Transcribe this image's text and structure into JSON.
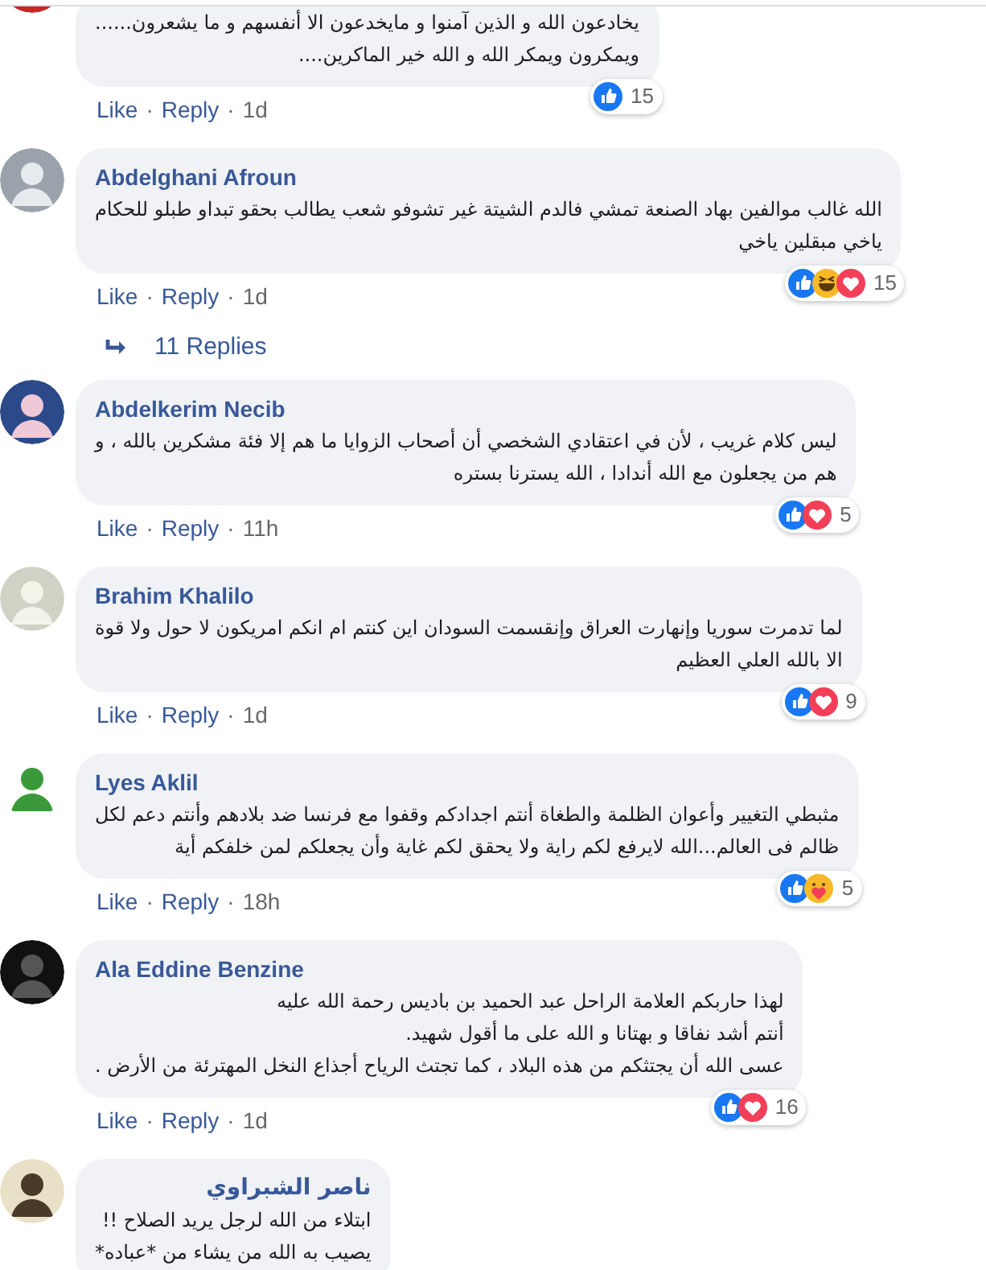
{
  "comments": [
    {
      "lines": [
        "يخادعون الله و الذين آمنوا و مايخدعون الا أنفسهم و ما يشعرون......",
        "ويمكرون ويمكر الله و الله خير الماكرين...."
      ],
      "reactions": {
        "icons": [
          {
            "kind": "like"
          }
        ],
        "count": "15"
      },
      "actions": {
        "like": "Like",
        "separator_1": "·",
        "reply": "Reply",
        "separator_2": "·",
        "time": "1d"
      }
    },
    {
      "name": "Abdelghani Afroun",
      "lines": [
        "الله غالب موالفين بهاد الصنعة تمشي فالدم الشيتة غير تشوفو شعب يطالب بحقو تبداو طبلو للحكام",
        "ياخي مبقلين ياخي"
      ],
      "reactions": {
        "icons": [
          {
            "kind": "like"
          },
          {
            "kind": "haha"
          },
          {
            "kind": "love"
          }
        ],
        "count": "15"
      },
      "actions": {
        "like": "Like",
        "separator_1": "·",
        "reply": "Reply",
        "separator_2": "·",
        "time": "1d"
      },
      "replies": "11 Replies"
    },
    {
      "name": "Abdelkerim Necib",
      "lines": [
        "ليس كلام غريب ، لأن في اعتقادي الشخصي أن أصحاب الزوايا ما هم إلا فئة مشكرين بالله ، و",
        "هم من يجعلون مع الله أندادا ، الله يسترنا بستره"
      ],
      "reactions": {
        "icons": [
          {
            "kind": "like"
          },
          {
            "kind": "love"
          }
        ],
        "count": "5"
      },
      "actions": {
        "like": "Like",
        "separator_1": "·",
        "reply": "Reply",
        "separator_2": "·",
        "time": "11h"
      }
    },
    {
      "name": "Brahim Khalilo",
      "lines": [
        "لما تدمرت سوريا وإنهارت العراق وإنقسمت السودان اين كنتم ام انكم امريكون لا حول ولا قوة",
        "الا بالله العلي العظيم"
      ],
      "reactions": {
        "icons": [
          {
            "kind": "like"
          },
          {
            "kind": "love"
          }
        ],
        "count": "9"
      },
      "actions": {
        "like": "Like",
        "separator_1": "·",
        "reply": "Reply",
        "separator_2": "·",
        "time": "1d"
      }
    },
    {
      "name": "Lyes Aklil",
      "lines": [
        "مثبطي التغيير وأعوان الظلمة والطغاة أنتم اجدادكم وقفوا مع فرنسا ضد بلادهم وأنتم دعم لكل",
        "ظالم فى العالم...الله لايرفع لكم راية ولا يحقق لكم غاية وأن يجعلكم لمن خلفكم أية"
      ],
      "reactions": {
        "icons": [
          {
            "kind": "like"
          },
          {
            "kind": "care"
          }
        ],
        "count": "5"
      },
      "actions": {
        "like": "Like",
        "separator_1": "·",
        "reply": "Reply",
        "separator_2": "·",
        "time": "18h"
      }
    },
    {
      "name": "Ala Eddine Benzine",
      "lines": [
        "لهذا حاربكم العلامة الراحل عبد الحميد بن باديس رحمة الله عليه",
        "أنتم أشد نفاقا و بهتانا و الله على ما أقول شهيد.",
        "عسى الله أن يجتثكم من هذه البلاد ، كما تجتث الرياح أجذاع النخل المهترئة من الأرض ."
      ],
      "reactions": {
        "icons": [
          {
            "kind": "like"
          },
          {
            "kind": "love"
          }
        ],
        "count": "16"
      },
      "actions": {
        "like": "Like",
        "separator_1": "·",
        "reply": "Reply",
        "separator_2": "·",
        "time": "1d"
      }
    },
    {
      "name": "ناصر الشبراوي",
      "lines": [
        "ابتلاء من الله لرجل يريد الصلاح !!",
        "يصيب به الله من يشاء من *عباده*"
      ]
    }
  ]
}
